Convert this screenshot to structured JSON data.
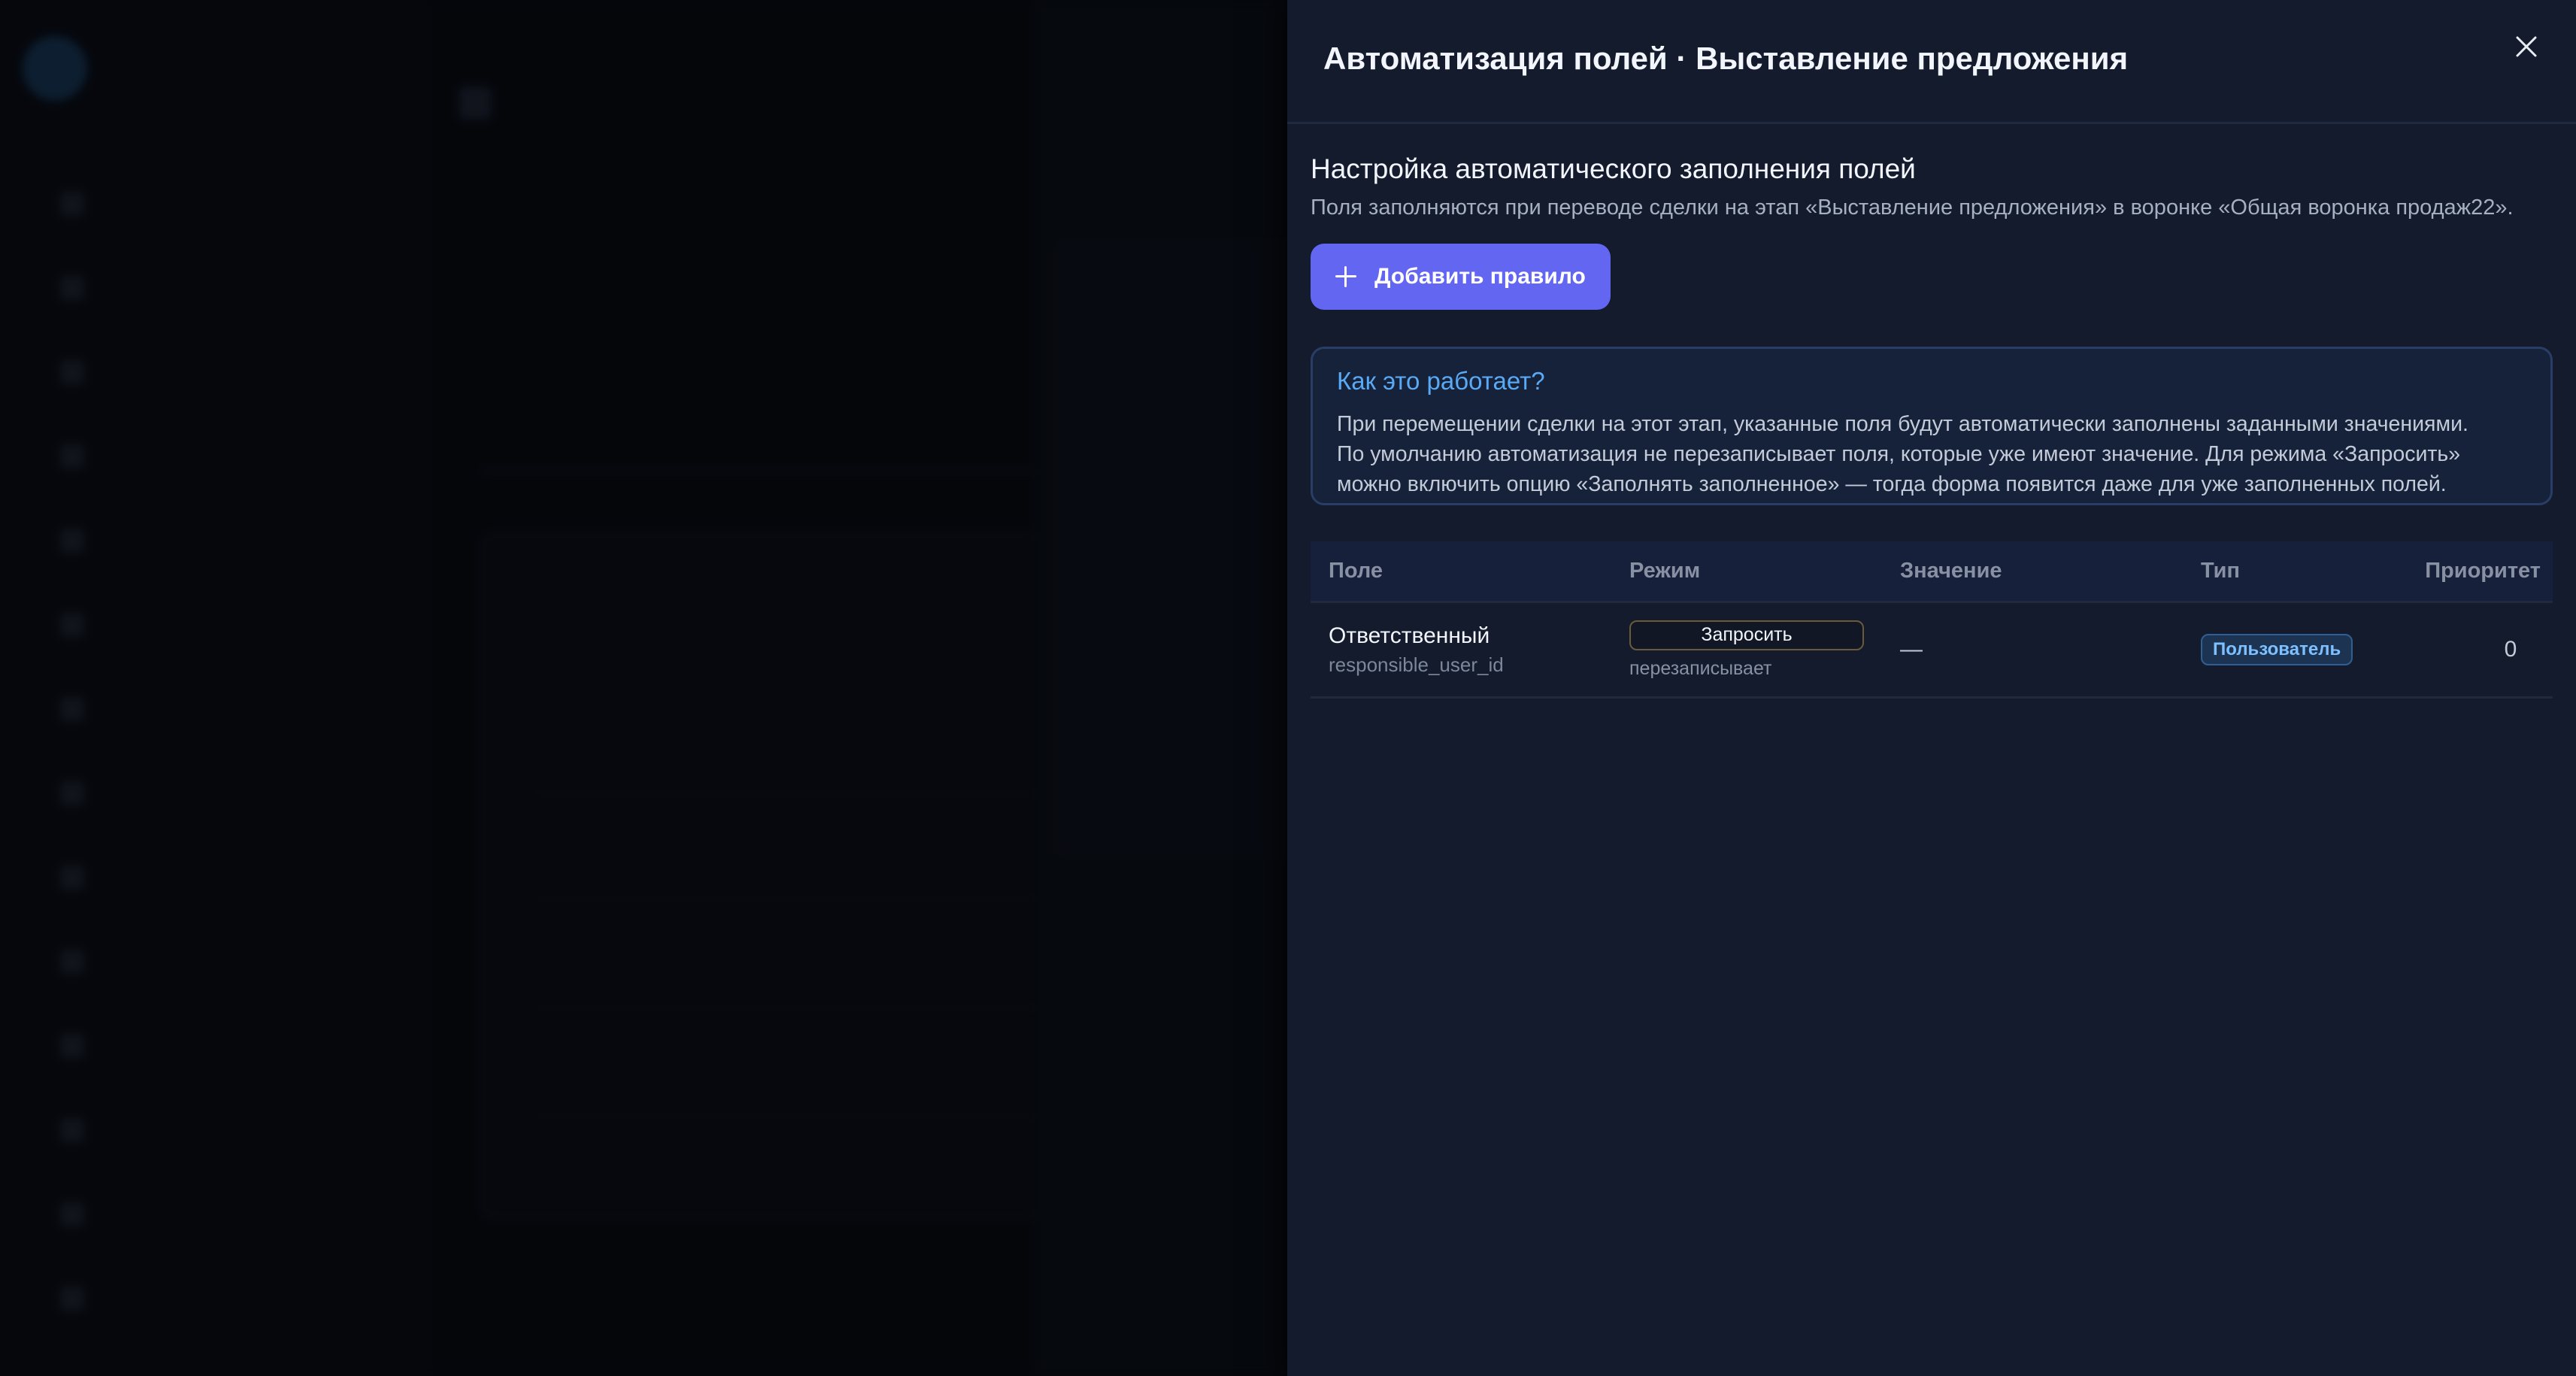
{
  "drawer": {
    "title": "Автоматизация полей · Выставление предложения",
    "section_title": "Настройка автоматического заполнения полей",
    "section_desc": "Поля заполняются при переводе сделки на этап «Выставление предложения» в воронке «Общая воронка продаж22».",
    "add_button_label": "Добавить правило",
    "info": {
      "title": "Как это работает?",
      "lines": [
        "При перемещении сделки на этот этап, указанные поля будут автоматически заполнены заданными значениями.",
        "По умолчанию автоматизация не перезаписывает поля, которые уже имеют значение. Для режима «Запросить»",
        "можно включить опцию «Заполнять заполненное» — тогда форма появится даже для уже заполненных полей."
      ]
    },
    "table": {
      "headers": {
        "field": "Поле",
        "mode": "Режим",
        "value": "Значение",
        "type": "Тип",
        "priority": "Приоритет"
      },
      "rows": [
        {
          "field_name": "Ответственный",
          "field_key": "responsible_user_id",
          "mode": "Запросить",
          "mode_sub": "перезаписывает",
          "value": "—",
          "type": "Пользователь",
          "priority": "0"
        }
      ]
    }
  },
  "colors": {
    "accent": "#6366f1",
    "drawer_bg": "#131b2c",
    "info_title": "#5aa9f5",
    "type_badge": "#7ec0ff"
  },
  "icons": {
    "close": "close-icon",
    "add": "plus-icon"
  }
}
